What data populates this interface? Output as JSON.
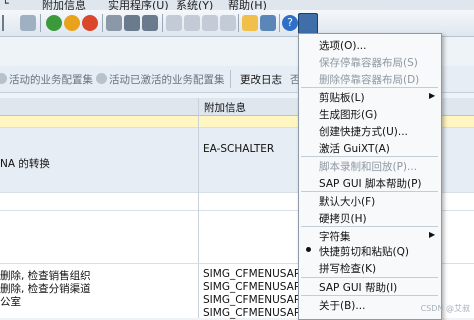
{
  "menubar": {
    "items": [
      {
        "label": "附加信息"
      },
      {
        "label": "实用程序(U)"
      },
      {
        "label": "系统(Y)"
      },
      {
        "label": "帮助(H)"
      }
    ]
  },
  "app_toolbar": {
    "btn1_label": "活动的业务配置集",
    "btn2_label": "活动已激活的业务配置集",
    "btn3_label": "更改日志",
    "btn4_label": "否"
  },
  "table": {
    "col_header": "附加信息",
    "rows": [
      {
        "left": "NA 的转换",
        "right": "EA-SCHALTER"
      },
      {
        "left": "删除, 检查销售组织",
        "right": "SIMG_CFMENUSAPCOV"
      },
      {
        "left": "删除, 检查分销渠道",
        "right": "SIMG_CFMENUSAPCOV"
      },
      {
        "left": "公室",
        "right": "SIMG_CFMENUSAPCOV"
      },
      {
        "left": "",
        "right": "SIMG_CFMENUSAPCOV"
      }
    ]
  },
  "context_menu": {
    "items": [
      {
        "label": "选项(O)...",
        "enabled": true
      },
      {
        "label": "保存停靠容器布局(S)",
        "enabled": false
      },
      {
        "label": "删除停靠容器布局(D)",
        "enabled": false
      },
      {
        "label": "剪贴板(L)",
        "enabled": true,
        "submenu": true
      },
      {
        "label": "生成图形(G)",
        "enabled": true
      },
      {
        "label": "创建快捷方式(U)...",
        "enabled": true
      },
      {
        "label": "激活 GuiXT(A)",
        "enabled": true
      },
      {
        "label": "脚本录制和回放(P)...",
        "enabled": false
      },
      {
        "label": "SAP GUI 脚本帮助(P)",
        "enabled": true
      },
      {
        "label": "默认大小(F)",
        "enabled": true
      },
      {
        "label": "硬拷贝(H)",
        "enabled": true
      },
      {
        "label": "字符集",
        "enabled": true,
        "submenu": true
      },
      {
        "label": "快捷剪切和粘贴(Q)",
        "enabled": true,
        "checked": true
      },
      {
        "label": "拼写检查(K)",
        "enabled": true
      },
      {
        "label": "SAP GUI 帮助(I)",
        "enabled": true
      },
      {
        "label": "关于(B)...",
        "enabled": true
      }
    ]
  },
  "watermark": "CSDN @艾叔"
}
